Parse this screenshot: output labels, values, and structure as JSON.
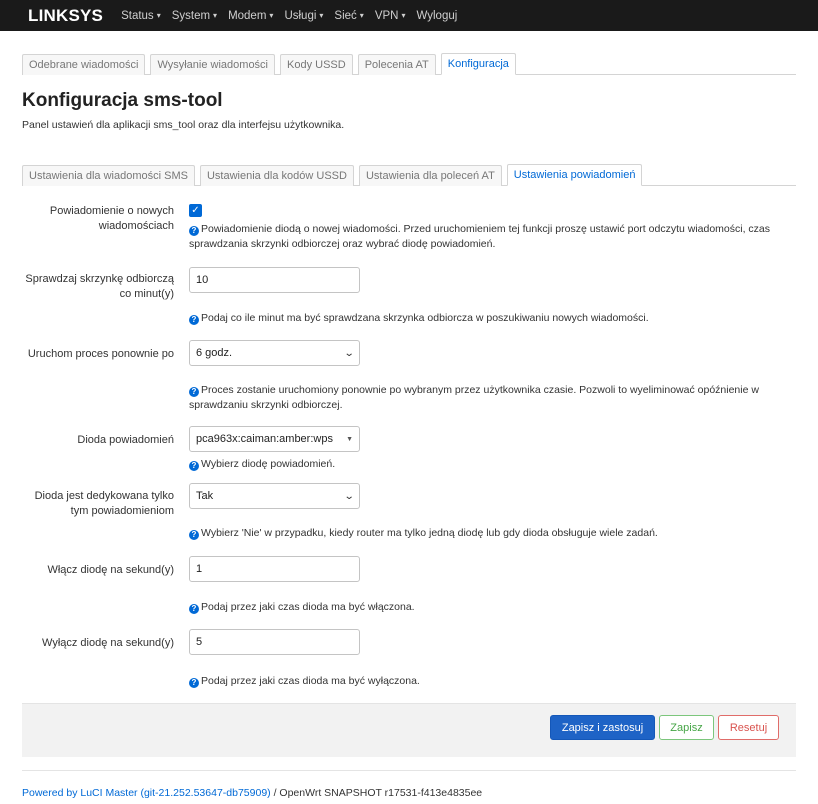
{
  "navbar": {
    "brand": "LINKSYS",
    "items": [
      {
        "label": "Status",
        "caret": "▾"
      },
      {
        "label": "System",
        "caret": "▾"
      },
      {
        "label": "Modem",
        "caret": "▾"
      },
      {
        "label": "Usługi",
        "caret": "▾"
      },
      {
        "label": "Sieć",
        "caret": "▾"
      },
      {
        "label": "VPN",
        "caret": "▾"
      },
      {
        "label": "Wyloguj",
        "caret": ""
      }
    ]
  },
  "top_tabs": [
    {
      "label": "Odebrane wiadomości",
      "active": false
    },
    {
      "label": "Wysyłanie wiadomości",
      "active": false
    },
    {
      "label": "Kody USSD",
      "active": false
    },
    {
      "label": "Polecenia AT",
      "active": false
    },
    {
      "label": "Konfiguracja",
      "active": true
    }
  ],
  "page": {
    "title": "Konfiguracja sms-tool",
    "description": "Panel ustawień dla aplikacji sms_tool oraz dla interfejsu użytkownika."
  },
  "sub_tabs": [
    {
      "label": "Ustawienia dla wiadomości SMS",
      "active": false
    },
    {
      "label": "Ustawienia dla kodów USSD",
      "active": false
    },
    {
      "label": "Ustawienia dla poleceń AT",
      "active": false
    },
    {
      "label": "Ustawienia powiadomień",
      "active": true
    }
  ],
  "form": {
    "notify_new": {
      "label": "Powiadomienie o nowych wiadomościach",
      "checked": true,
      "help": "Powiadomienie diodą o nowej wiadomości. Przed uruchomieniem tej funkcji proszę ustawić port odczytu wiadomości, czas sprawdzania skrzynki odbiorczej oraz wybrać diodę powiadomień."
    },
    "check_interval": {
      "label": "Sprawdzaj skrzynkę odbiorczą co minut(y)",
      "value": "10",
      "help": "Podaj co ile minut ma być sprawdzana skrzynka odbiorcza w poszukiwaniu nowych wiadomości."
    },
    "restart_after": {
      "label": "Uruchom proces ponownie po",
      "value": "6 godz.",
      "help": "Proces zostanie uruchomiony ponownie po wybranym przez użytkownika czasie. Pozwoli to wyeliminować opóźnienie w sprawdzaniu skrzynki odbiorczej."
    },
    "led": {
      "label": "Dioda powiadomień",
      "value": "pca963x:caiman:amber:wps",
      "help": "Wybierz diodę powiadomień."
    },
    "led_dedicated": {
      "label": "Dioda jest dedykowana tylko tym powiadomieniom",
      "value": "Tak",
      "help": "Wybierz 'Nie' w przypadku, kiedy router ma tylko jedną diodę lub gdy dioda obsługuje wiele zadań."
    },
    "led_on": {
      "label": "Włącz diodę na sekund(y)",
      "value": "1",
      "help": "Podaj przez jaki czas dioda ma być włączona."
    },
    "led_off": {
      "label": "Wyłącz diodę na sekund(y)",
      "value": "5",
      "help": "Podaj przez jaki czas dioda ma być wyłączona."
    }
  },
  "actions": {
    "save_apply": "Zapisz i zastosuj",
    "save": "Zapisz",
    "reset": "Resetuj"
  },
  "footer": {
    "link_text": "Powered by LuCI Master (git-21.252.53647-db75909)",
    "separator": " / ",
    "suffix": "OpenWrt SNAPSHOT r17531-f413e4835ee"
  },
  "colors": {
    "navbar_bg": "#1a1a1a",
    "accent": "#0069d6",
    "primary_button": "#1e63c6",
    "success": "#46a546",
    "danger": "#d9534f"
  },
  "icons": {
    "help": "question-circle-icon",
    "dropdown": "chevron-down-icon",
    "checkbox": "check-icon"
  }
}
